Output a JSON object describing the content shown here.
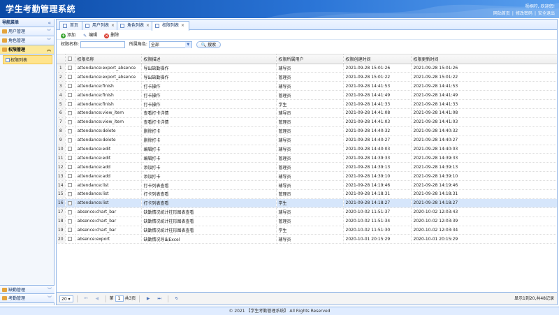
{
  "header": {
    "title": "学生考勤管理系统",
    "welcome": "杨桐柠, 欢迎您!",
    "links": [
      "网站首页",
      "修改密码",
      "安全退出"
    ]
  },
  "sidebar": {
    "title": "导航菜单",
    "groups": [
      {
        "label": "用户管理"
      },
      {
        "label": "角色管理"
      },
      {
        "label": "权限管理"
      }
    ],
    "sub_item": "权限列表",
    "bottom_groups": [
      {
        "label": "缺勤管理"
      },
      {
        "label": "考勤管理"
      }
    ]
  },
  "tabs": [
    {
      "label": "首页"
    },
    {
      "label": "用户列表"
    },
    {
      "label": "角色列表"
    },
    {
      "label": "权限列表"
    }
  ],
  "toolbar": {
    "add": "添加",
    "edit": "编辑",
    "delete": "删除"
  },
  "search": {
    "name_label": "权限名称:",
    "name_value": "",
    "role_label": "所属角色:",
    "role_value": "全部",
    "button": "搜索"
  },
  "table": {
    "columns": [
      "权限名称",
      "权限描述",
      "权限所属用户",
      "权限创建时间",
      "权限更新时间"
    ],
    "rows": [
      [
        "1",
        "attendance:export_absence",
        "导出缺勤操作",
        "辅导员",
        "2021-09-28 15:01:26",
        "2021-09-28 15:01:26"
      ],
      [
        "2",
        "attendance:export_absence",
        "导出缺勤操作",
        "管理员",
        "2021-09-28 15:01:22",
        "2021-09-28 15:01:22"
      ],
      [
        "3",
        "attendance:finish",
        "打卡操作",
        "辅导员",
        "2021-09-28 14:41:53",
        "2021-09-28 14:41:53"
      ],
      [
        "4",
        "attendance:finish",
        "打卡操作",
        "管理员",
        "2021-09-28 14:41:49",
        "2021-09-28 14:41:49"
      ],
      [
        "5",
        "attendance:finish",
        "打卡操作",
        "学生",
        "2021-09-28 14:41:33",
        "2021-09-28 14:41:33"
      ],
      [
        "6",
        "attendance:view_item",
        "查看打卡详情",
        "辅导员",
        "2021-09-28 14:41:08",
        "2021-09-28 14:41:08"
      ],
      [
        "7",
        "attendance:view_item",
        "查看打卡详情",
        "管理员",
        "2021-09-28 14:41:03",
        "2021-09-28 14:41:03"
      ],
      [
        "8",
        "attendance:delete",
        "删除打卡",
        "管理员",
        "2021-09-28 14:40:32",
        "2021-09-28 14:40:32"
      ],
      [
        "9",
        "attendance:delete",
        "删除打卡",
        "辅导员",
        "2021-09-28 14:40:27",
        "2021-09-28 14:40:27"
      ],
      [
        "10",
        "attendance:edit",
        "编辑打卡",
        "辅导员",
        "2021-09-28 14:40:03",
        "2021-09-28 14:40:03"
      ],
      [
        "11",
        "attendance:edit",
        "编辑打卡",
        "管理员",
        "2021-09-28 14:39:33",
        "2021-09-28 14:39:33"
      ],
      [
        "12",
        "attendance:add",
        "添加打卡",
        "管理员",
        "2021-09-28 14:39:13",
        "2021-09-28 14:39:13"
      ],
      [
        "13",
        "attendance:add",
        "添加打卡",
        "辅导员",
        "2021-09-28 14:39:10",
        "2021-09-28 14:39:10"
      ],
      [
        "14",
        "attendance:list",
        "打卡列表查看",
        "辅导员",
        "2021-09-28 14:19:46",
        "2021-09-28 14:19:46"
      ],
      [
        "15",
        "attendance:list",
        "打卡列表查看",
        "管理员",
        "2021-09-28 14:18:31",
        "2021-09-28 14:18:31"
      ],
      [
        "16",
        "attendance:list",
        "打卡列表查看",
        "学生",
        "2021-09-28 14:18:27",
        "2021-09-28 14:18:27"
      ],
      [
        "17",
        "absence:chart_bar",
        "缺勤情况统计柱形图表查看",
        "辅导员",
        "2020-10-02 11:51:37",
        "2020-10-02 12:03:43"
      ],
      [
        "18",
        "absence:chart_bar",
        "缺勤情况统计柱形图表查看",
        "管理员",
        "2020-10-02 11:51:34",
        "2020-10-02 12:03:39"
      ],
      [
        "19",
        "absence:chart_bar",
        "缺勤情况统计柱形图表查看",
        "学生",
        "2020-10-02 11:51:30",
        "2020-10-02 12:03:34"
      ],
      [
        "20",
        "absence:export",
        "缺勤情况导出Excel",
        "辅导员",
        "2020-10-01 20:15:29",
        "2020-10-01 20:15:29"
      ]
    ]
  },
  "pager": {
    "page_size": "20",
    "page_prefix": "第",
    "page_value": "1",
    "page_suffix": "共3页",
    "info": "显示1到20,共48记录"
  },
  "footer": "© 2021 【学生考勤管理系统】 All Rights Reserved",
  "colors": {
    "brand": "#1f64c6",
    "border": "#95b8e7",
    "active": "#fce99b"
  }
}
